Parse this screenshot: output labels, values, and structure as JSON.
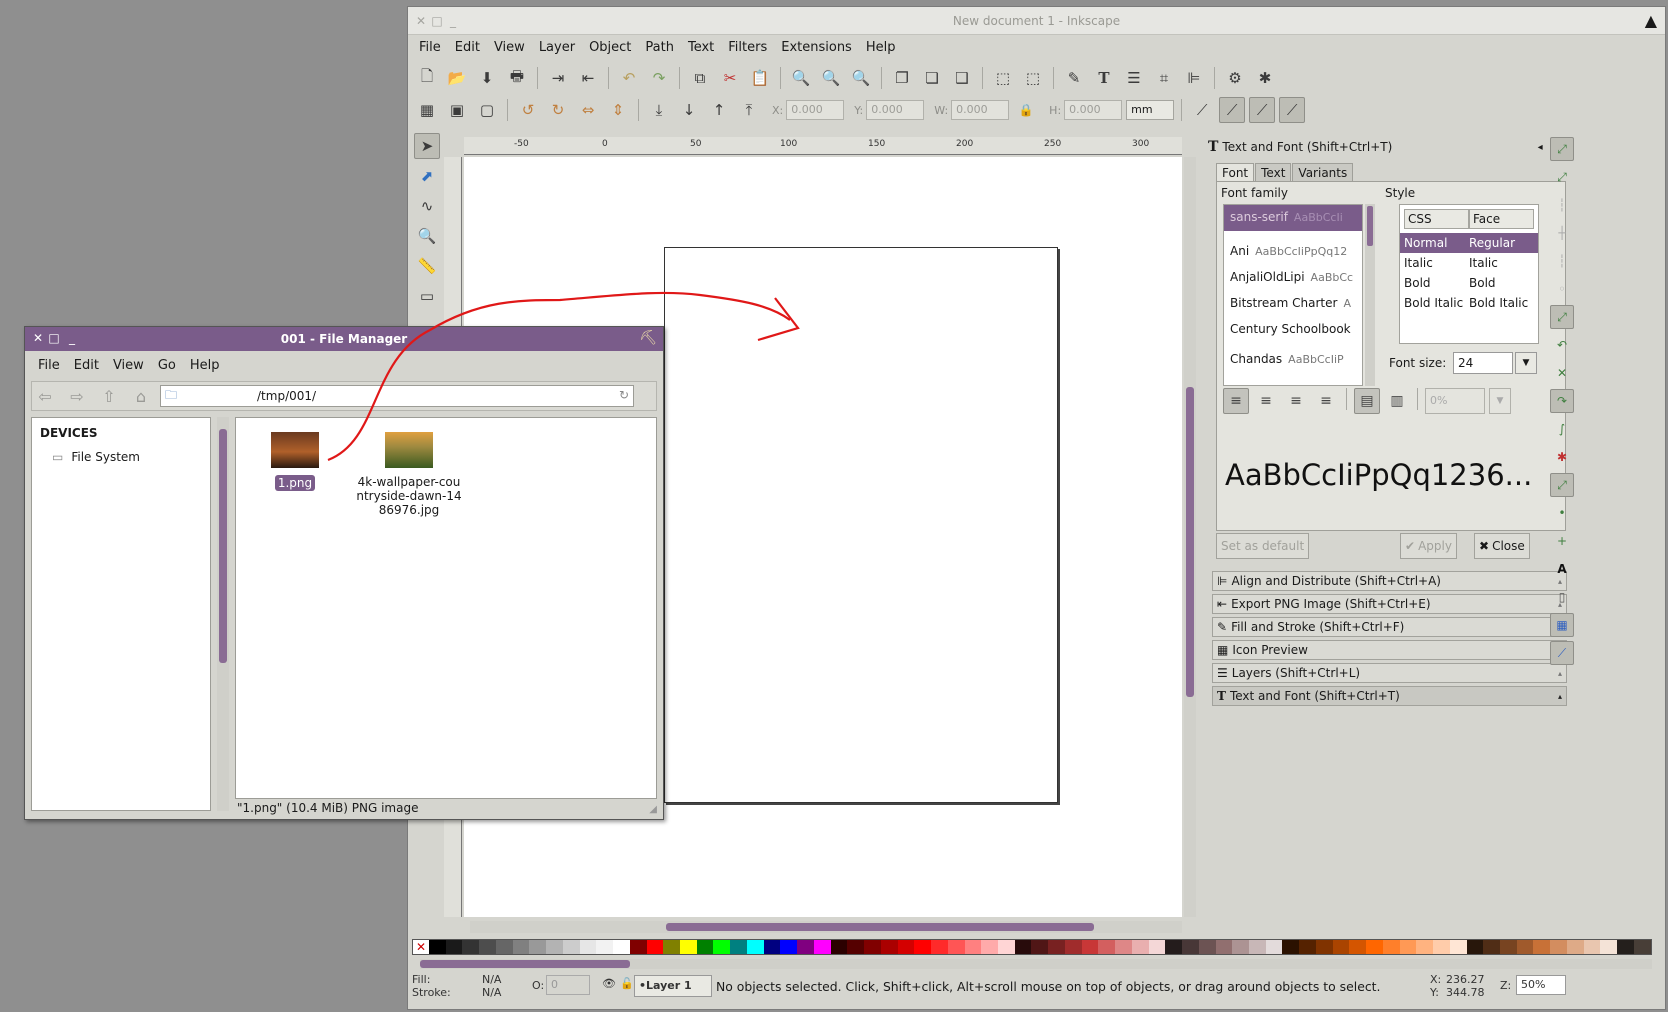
{
  "inkscape": {
    "title": "New document 1 - Inkscape",
    "menu": [
      "File",
      "Edit",
      "View",
      "Layer",
      "Object",
      "Path",
      "Text",
      "Filters",
      "Extensions",
      "Help"
    ],
    "coords": {
      "x_label": "X:",
      "x_value": "0.000",
      "y_label": "Y:",
      "y_value": "0.000",
      "w_label": "W:",
      "w_value": "0.000",
      "h_label": "H:",
      "h_value": "0.000",
      "unit": "mm"
    },
    "ruler_labels": [
      "-50",
      "0",
      "50",
      "100",
      "150",
      "200",
      "250",
      "300"
    ],
    "status": {
      "fill_label": "Fill:",
      "fill_value": "N/A",
      "stroke_label": "Stroke:",
      "stroke_value": "N/A",
      "opacity_label": "O:",
      "opacity_value": "0",
      "layer": "•Layer 1",
      "message": "No objects selected. Click, Shift+click, Alt+scroll mouse on top of objects, or drag around objects to select.",
      "x_label": "X:",
      "x_value": "236.27",
      "y_label": "Y:",
      "y_value": "344.78",
      "zoom_label": "Z:",
      "zoom_value": "50%"
    }
  },
  "text_font": {
    "title": "Text and Font (Shift+Ctrl+T)",
    "tabs": [
      "Font",
      "Text",
      "Variants"
    ],
    "font_family_label": "Font family",
    "families": [
      {
        "name": "sans-serif",
        "preview": "AaBbCcIi"
      },
      {
        "name": "Ani",
        "preview": "AaBbCcIiPpQq12"
      },
      {
        "name": "AnjaliOldLipi",
        "preview": "AaBbCc"
      },
      {
        "name": "Bitstream Charter",
        "preview": "A"
      },
      {
        "name": "Century Schoolbook",
        "preview": ""
      },
      {
        "name": "Chandas",
        "preview": "AaBbCcIiP"
      }
    ],
    "style_label": "Style",
    "style_headers": [
      "CSS",
      "Face"
    ],
    "styles": [
      {
        "css": "Normal",
        "face": "Regular"
      },
      {
        "css": "Italic",
        "face": "Italic"
      },
      {
        "css": "Bold",
        "face": "Bold"
      },
      {
        "css": "Bold Italic",
        "face": "Bold Italic"
      }
    ],
    "font_size_label": "Font size:",
    "font_size_value": "24",
    "line_spacing_value": "0%",
    "preview_text": "AaBbCcIiPpQq1236...",
    "set_default_label": "Set as default",
    "apply_label": "Apply",
    "close_label": "Close"
  },
  "docked_dialogs": [
    "Align and Distribute (Shift+Ctrl+A)",
    "Export PNG Image (Shift+Ctrl+E)",
    "Fill and Stroke (Shift+Ctrl+F)",
    "Icon Preview",
    "Layers (Shift+Ctrl+L)",
    "Text and Font (Shift+Ctrl+T)"
  ],
  "file_manager": {
    "title": "001 - File Manager",
    "menu": [
      "File",
      "Edit",
      "View",
      "Go",
      "Help"
    ],
    "path": "/tmp/001/",
    "devices_label": "DEVICES",
    "device": "File System",
    "files": [
      {
        "name": "1.png",
        "selected": true
      },
      {
        "name": "4k-wallpaper-countryside-dawn-1486976.jpg",
        "selected": false
      }
    ],
    "status": "\"1.png\" (10.4 MiB) PNG image"
  },
  "palette_colors": [
    "#000000",
    "#1a1a1a",
    "#333333",
    "#4d4d4d",
    "#666666",
    "#808080",
    "#999999",
    "#b3b3b3",
    "#cccccc",
    "#e6e6e6",
    "#f2f2f2",
    "#ffffff",
    "#800000",
    "#ff0000",
    "#808000",
    "#ffff00",
    "#008000",
    "#00ff00",
    "#008080",
    "#00ffff",
    "#000080",
    "#0000ff",
    "#800080",
    "#ff00ff",
    "#2b0000",
    "#550000",
    "#800000",
    "#aa0000",
    "#d40000",
    "#ff0000",
    "#ff2a2a",
    "#ff5555",
    "#ff8080",
    "#ffaaaa",
    "#ffd5d5",
    "#280b0b",
    "#501616",
    "#782121",
    "#a02c2c",
    "#c83737",
    "#d35f5f",
    "#de8787",
    "#e9afaf",
    "#f4d7d7",
    "#241c1c",
    "#483737",
    "#6c5353",
    "#916f6f",
    "#ac9393",
    "#c8b7b7",
    "#e3dbdb",
    "#2b1100",
    "#552200",
    "#803300",
    "#aa4400",
    "#d45500",
    "#ff6600",
    "#ff7f2a",
    "#ff9955",
    "#ffb380",
    "#ffccaa",
    "#ffe6d5",
    "#28170b",
    "#502d16",
    "#784421",
    "#a05a2c",
    "#c87137",
    "#d38d5f",
    "#deaa87",
    "#e9c6af",
    "#f4e3d7",
    "#241f1c",
    "#483e37"
  ]
}
